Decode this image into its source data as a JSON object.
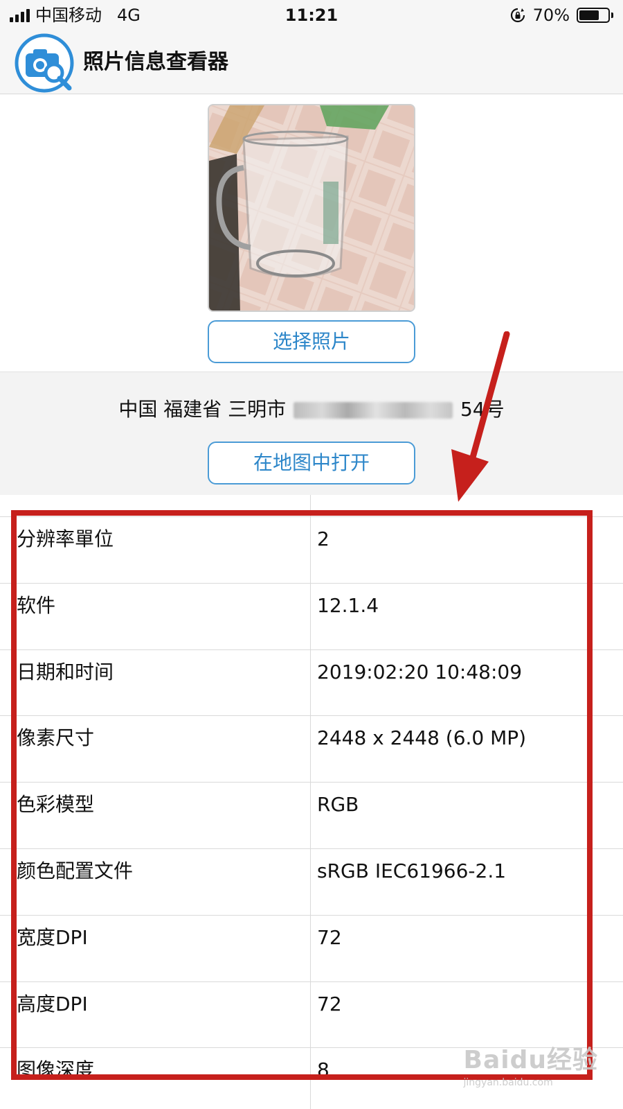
{
  "status_bar": {
    "carrier": "中国移动",
    "network": "4G",
    "time": "11:21",
    "battery_text": "70%",
    "battery_level": 0.7
  },
  "header": {
    "title": "照片信息查看器",
    "logo_icon": "camera-search-icon",
    "accent": "#2f8ed8"
  },
  "photo": {
    "thumbnail_icon": "photo-thumbnail",
    "choose_button": "选择照片"
  },
  "location": {
    "address_prefix": "中国 福建省 三明市",
    "address_suffix": "54号",
    "open_map_button": "在地图中打开"
  },
  "info_rows": [
    {
      "label": "分辨率單位",
      "value": "2"
    },
    {
      "label": "软件",
      "value": "12.1.4"
    },
    {
      "label": "日期和时间",
      "value": "2019:02:20 10:48:09"
    },
    {
      "label": "像素尺寸",
      "value": "2448 x 2448 (6.0 MP)"
    },
    {
      "label": "色彩模型",
      "value": "RGB"
    },
    {
      "label": "颜色配置文件",
      "value": "sRGB IEC61966-2.1"
    },
    {
      "label": "宽度DPI",
      "value": "72"
    },
    {
      "label": "高度DPI",
      "value": "72"
    },
    {
      "label": "图像深度",
      "value": "8"
    }
  ],
  "annotation": {
    "color": "#c6201c"
  },
  "watermark": {
    "main": "Baidu经验",
    "sub": "jingyan.baidu.com"
  }
}
